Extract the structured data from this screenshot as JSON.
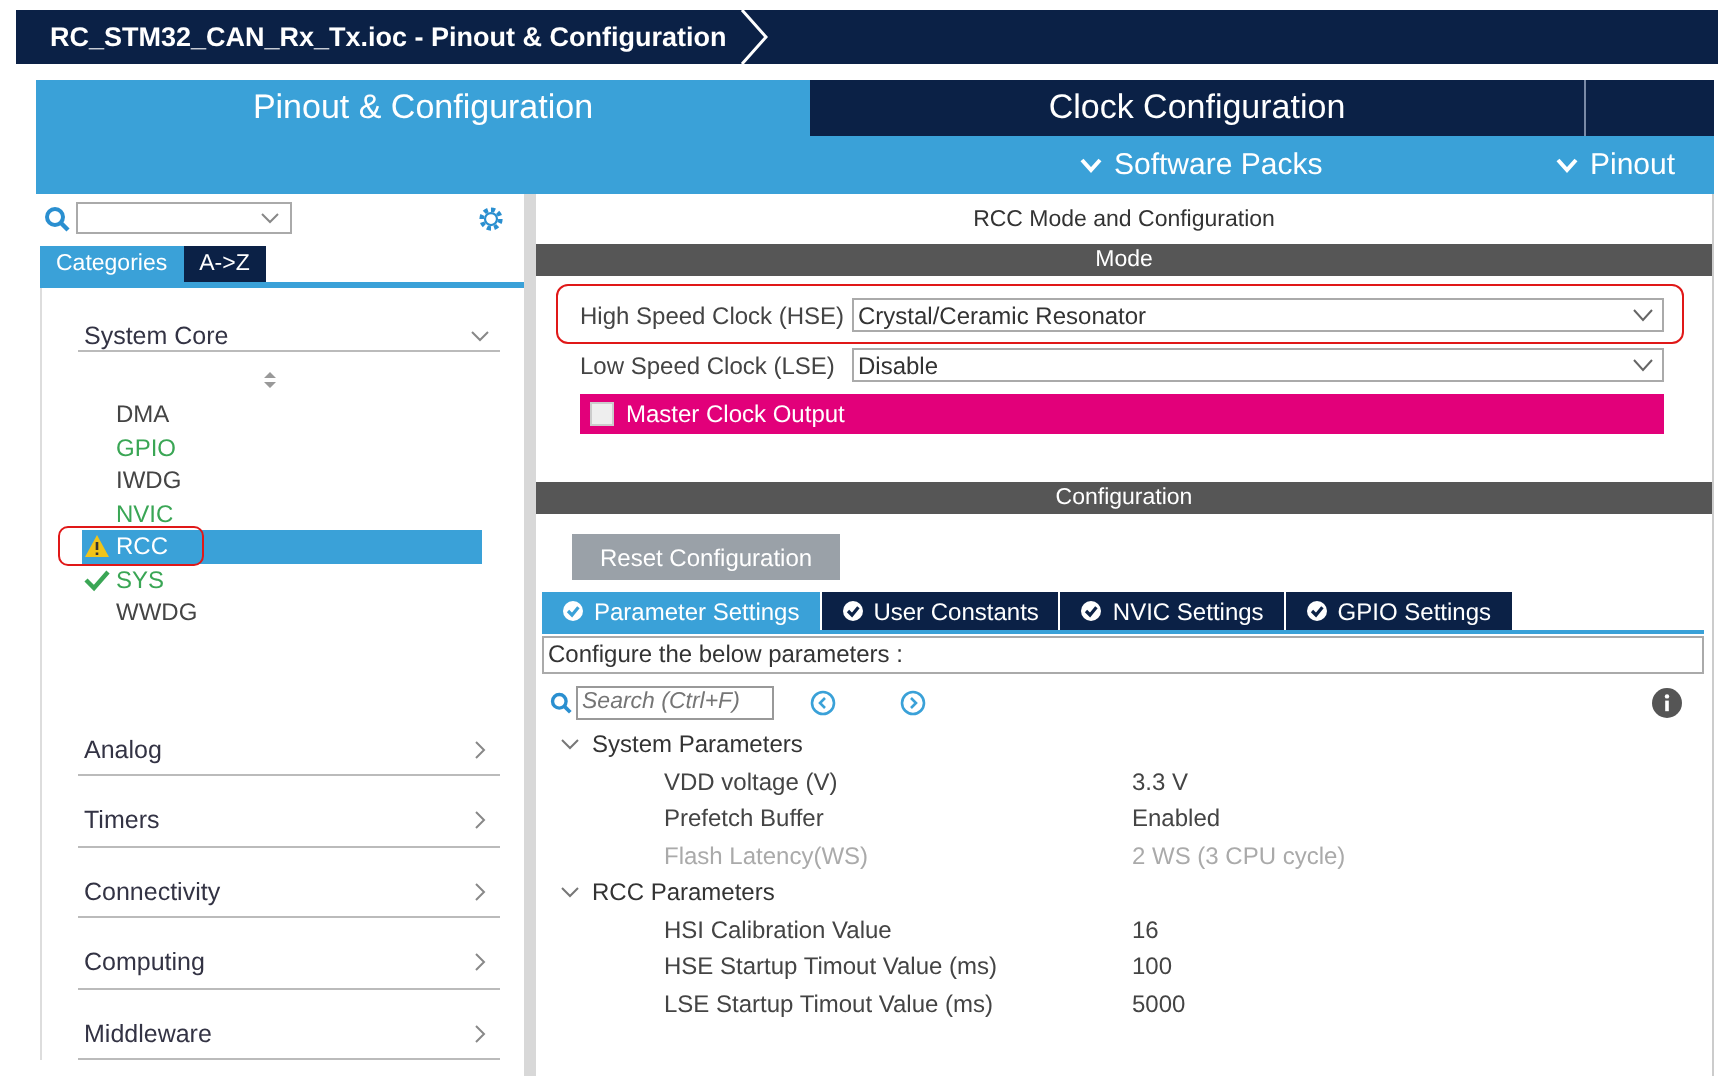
{
  "title_bar": {
    "title": "RC_STM32_CAN_Rx_Tx.ioc - Pinout & Configuration"
  },
  "main_tabs": [
    {
      "label": "Pinout & Configuration",
      "selected": true
    },
    {
      "label": "Clock Configuration",
      "selected": false
    }
  ],
  "menus": [
    {
      "label": "Software Packs"
    },
    {
      "label": "Pinout"
    }
  ],
  "sidebar": {
    "view_tabs": [
      {
        "label": "Categories",
        "selected": true
      },
      {
        "label": "A->Z",
        "selected": false
      }
    ],
    "groups": [
      {
        "label": "System Core",
        "expanded": true,
        "items": [
          {
            "label": "DMA",
            "configured": false,
            "kind": "plain",
            "selected": false,
            "annotated": false
          },
          {
            "label": "GPIO",
            "configured": true,
            "kind": "plain",
            "selected": false,
            "annotated": false
          },
          {
            "label": "IWDG",
            "configured": false,
            "kind": "plain",
            "selected": false,
            "annotated": false
          },
          {
            "label": "NVIC",
            "configured": true,
            "kind": "plain",
            "selected": false,
            "annotated": false
          },
          {
            "label": "RCC",
            "configured": false,
            "kind": "warning",
            "selected": true,
            "annotated": true
          },
          {
            "label": "SYS",
            "configured": true,
            "kind": "ok",
            "selected": false,
            "annotated": false
          },
          {
            "label": "WWDG",
            "configured": false,
            "kind": "plain",
            "selected": false,
            "annotated": false
          }
        ]
      },
      {
        "label": "Analog",
        "expanded": false
      },
      {
        "label": "Timers",
        "expanded": false
      },
      {
        "label": "Connectivity",
        "expanded": false
      },
      {
        "label": "Computing",
        "expanded": false
      },
      {
        "label": "Middleware",
        "expanded": false
      }
    ]
  },
  "panel": {
    "title": "RCC Mode and Configuration",
    "mode_header": "Mode",
    "mode_rows": [
      {
        "kind": "select",
        "label": "High Speed Clock (HSE)",
        "value": "Crystal/Ceramic Resonator",
        "annotated": true
      },
      {
        "kind": "select",
        "label": "Low Speed Clock (LSE)",
        "value": "Disable",
        "annotated": false
      },
      {
        "kind": "checkbox",
        "label": "Master Clock Output",
        "checked": false
      }
    ],
    "config_header": "Configuration",
    "reset_button": "Reset Configuration",
    "config_tabs": [
      {
        "label": "Parameter Settings",
        "selected": true
      },
      {
        "label": "User Constants",
        "selected": false
      },
      {
        "label": "NVIC Settings",
        "selected": false
      },
      {
        "label": "GPIO Settings",
        "selected": false
      }
    ],
    "hint": "Configure the below parameters :",
    "search": {
      "placeholder": "Search (Ctrl+F)"
    },
    "groups": [
      {
        "label": "System Parameters",
        "expanded": true,
        "rows": [
          {
            "name": "VDD voltage (V)",
            "value": "3.3 V",
            "disabled": false
          },
          {
            "name": "Prefetch Buffer",
            "value": "Enabled",
            "disabled": false
          },
          {
            "name": "Flash Latency(WS)",
            "value": "2 WS (3 CPU cycle)",
            "disabled": true
          }
        ]
      },
      {
        "label": "RCC Parameters",
        "expanded": true,
        "rows": [
          {
            "name": "HSI Calibration Value",
            "value": "16",
            "disabled": false
          },
          {
            "name": "HSE Startup Timout Value (ms)",
            "value": "100",
            "disabled": false
          },
          {
            "name": "LSE Startup Timout Value (ms)",
            "value": "5000",
            "disabled": false
          }
        ]
      }
    ]
  }
}
